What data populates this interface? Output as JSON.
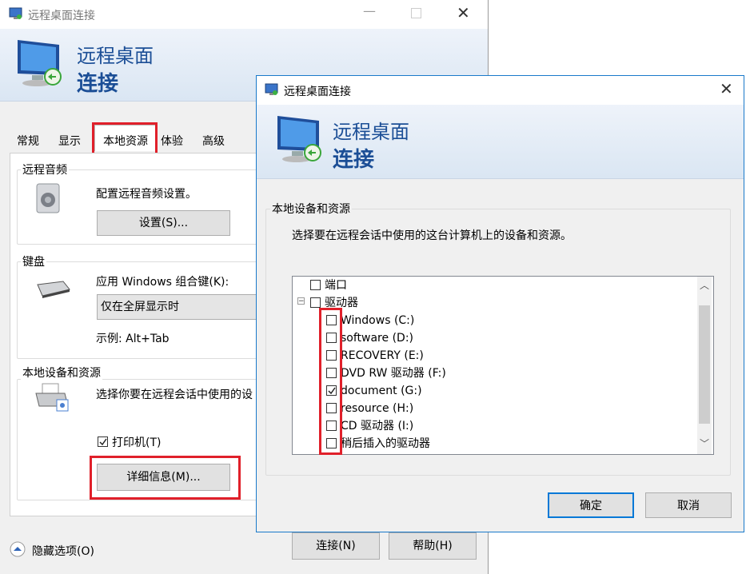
{
  "bg": {
    "title": "远程桌面连接",
    "banner_line1": "远程桌面",
    "banner_line2": "连接",
    "tabs": [
      {
        "label": "常规"
      },
      {
        "label": "显示"
      },
      {
        "label": "本地资源"
      },
      {
        "label": "体验"
      },
      {
        "label": "高级"
      }
    ],
    "audio": {
      "label": "远程音频",
      "desc": "配置远程音频设置。",
      "button": "设置(S)..."
    },
    "keyboard": {
      "label": "键盘",
      "desc": "应用 Windows 组合键(K):",
      "selected": "仅在全屏显示时",
      "example": "示例: Alt+Tab"
    },
    "local": {
      "label": "本地设备和资源",
      "desc": "选择你要在远程会话中使用的设",
      "printer": "打印机(T)",
      "details_button": "详细信息(M)..."
    },
    "hide_options": "隐藏选项(O)",
    "connect_button": "连接(N)",
    "help_button": "帮助(H)"
  },
  "dlg": {
    "title": "远程桌面连接",
    "banner_line1": "远程桌面",
    "banner_line2": "连接",
    "group_label": "本地设备和资源",
    "instruction": "选择要在远程会话中使用的这台计算机上的设备和资源。",
    "tree": {
      "ports": "端口",
      "drives": "驱动器",
      "drive_items": [
        {
          "label": "Windows (C:)",
          "checked": false
        },
        {
          "label": "software (D:)",
          "checked": false
        },
        {
          "label": "RECOVERY (E:)",
          "checked": false
        },
        {
          "label": "DVD RW 驱动器 (F:)",
          "checked": false
        },
        {
          "label": "document (G:)",
          "checked": true
        },
        {
          "label": "resource (H:)",
          "checked": false
        },
        {
          "label": "CD 驱动器 (I:)",
          "checked": false
        },
        {
          "label": "稍后插入的驱动器",
          "checked": false
        }
      ]
    },
    "ok_button": "确定",
    "cancel_button": "取消"
  },
  "colors": {
    "highlight": "#e0202a",
    "banner_text": "#1b4e96",
    "dialog_border": "#1979ca"
  }
}
